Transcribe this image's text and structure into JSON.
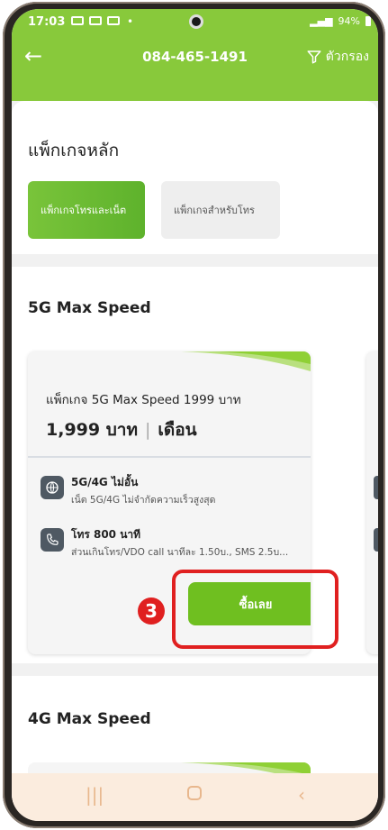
{
  "status_bar": {
    "time": "17:03",
    "dot": "•",
    "battery": "94%"
  },
  "header": {
    "back_icon": "←",
    "title": "084-465-1491",
    "filter_label": "ตัวกรอง"
  },
  "main_packages": {
    "heading": "แพ็กเกจหลัก",
    "chips": [
      {
        "label": "แพ็กเกจโทรและเน็ต",
        "active": true
      },
      {
        "label": "แพ็กเกจสำหรับโทร",
        "active": false
      }
    ]
  },
  "section_5g": {
    "heading": "5G Max Speed",
    "card": {
      "name": "แพ็กเกจ 5G Max Speed 1999 บาท",
      "price": "1,999 บาท",
      "period": "เดือน",
      "features": [
        {
          "title": "5G/4G ไม่อั้น",
          "desc": "เน็ต 5G/4G ไม่จำกัดความเร็วสูงสุด",
          "icon": "globe-icon"
        },
        {
          "title": "โทร 800 นาที",
          "desc": "ส่วนเกินโทร/VDO call นาทีละ 1.50บ., SMS 2.5บ...",
          "icon": "phone-icon"
        }
      ],
      "buy_label": "ซื้อเลย"
    },
    "step_badge": "3"
  },
  "section_4g": {
    "heading": "4G Max Speed"
  },
  "colors": {
    "brand_green": "#88c93b",
    "button_green": "#6fbf20",
    "highlight_red": "#e02020"
  },
  "nav_icons": [
    "recent-apps-icon",
    "home-icon",
    "back-icon"
  ]
}
